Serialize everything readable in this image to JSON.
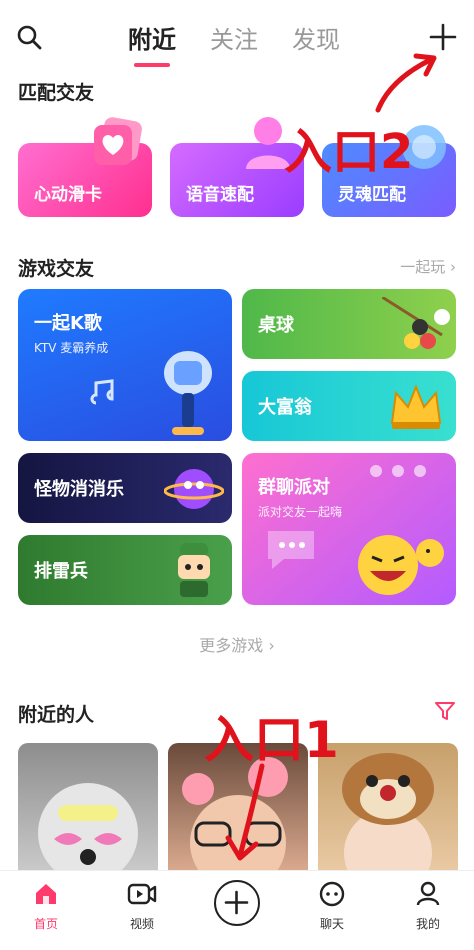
{
  "header": {
    "tabs": [
      "附近",
      "关注",
      "发现"
    ],
    "active_tab": "附近"
  },
  "match": {
    "title": "匹配交友",
    "cards": [
      "心动滑卡",
      "语音速配",
      "灵魂匹配"
    ]
  },
  "games": {
    "title": "游戏交友",
    "more": "一起玩",
    "ktv": {
      "title": "一起K歌",
      "sub": "KTV 麦霸养成"
    },
    "billiard": {
      "title": "桌球"
    },
    "rich": {
      "title": "大富翁"
    },
    "monster": {
      "title": "怪物消消乐"
    },
    "mine": {
      "title": "排雷兵"
    },
    "party": {
      "title": "群聊派对",
      "sub": "派对交友一起嗨"
    }
  },
  "more_games": "更多游戏",
  "nearby": {
    "title": "附近的人"
  },
  "bottom_nav": {
    "items": [
      "首页",
      "视频",
      "聊天",
      "我的"
    ],
    "active": "首页"
  },
  "annotations": [
    "入口2",
    "入口1"
  ],
  "colors": {
    "accent": "#ff3b6b",
    "annotation": "#e0131c"
  },
  "icons": {
    "search": "search-icon",
    "plus": "plus-icon",
    "filter": "filter-icon",
    "add": "add-circle-icon"
  }
}
